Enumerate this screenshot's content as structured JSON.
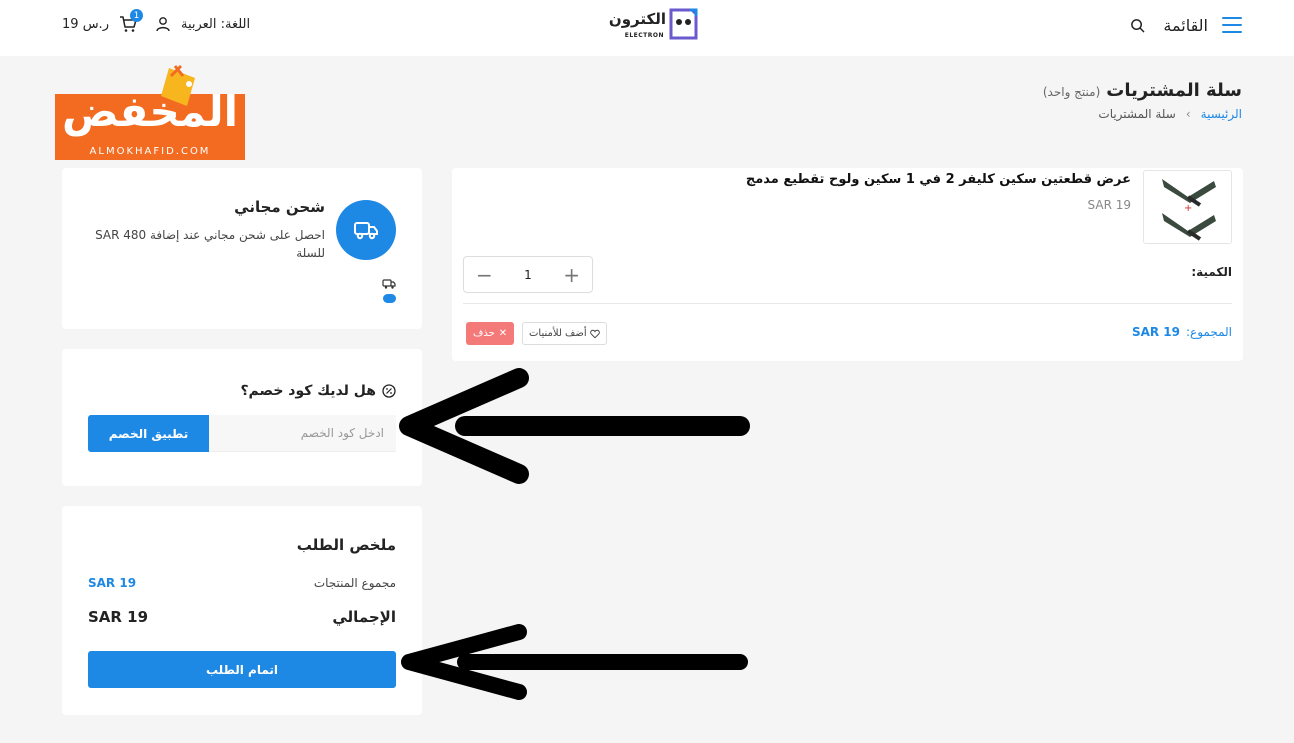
{
  "header": {
    "menu_label": "القائمة",
    "logo_ar": "الكترون",
    "logo_en": "ELECTRON",
    "language_label": "اللغة: العربية",
    "cart_total": "19 ر.س",
    "cart_count": "1"
  },
  "promo": {
    "text_ar": "المخفض",
    "text_en": "ALMOKHAFID.COM"
  },
  "page": {
    "title": "سلة المشتريات",
    "subtitle": "(منتج واحد)",
    "breadcrumb_home": "الرئيسية",
    "breadcrumb_sep": "›",
    "breadcrumb_current": "سلة المشتريات"
  },
  "product": {
    "name": "عرض قطعتين سكين كليفر 2 في 1 سكين ولوح تقطيع مدمج",
    "price": "SAR 19",
    "quantity_label": "الكمية:",
    "quantity": "1",
    "subtotal_label": "المجموع:",
    "subtotal_value": "SAR 19",
    "wishlist_label": "أضف للأمنيات",
    "delete_label": "حذف"
  },
  "shipping": {
    "title": "شحن مجاني",
    "description": "احصل على شحن مجاني عند إضافة 480 SAR للسلة"
  },
  "coupon": {
    "title": "هل لديك كود خصم؟",
    "placeholder": "ادخل كود الخصم",
    "apply_label": "تطبيق الخصم"
  },
  "summary": {
    "title": "ملخص الطلب",
    "products_total_label": "مجموع المنتجات",
    "products_total_value": "SAR 19",
    "grand_total_label": "الإجمالي",
    "grand_total_value": "SAR 19",
    "checkout_label": "اتمام الطلب"
  },
  "colors": {
    "accent": "#1e88e5",
    "promo_orange": "#f26b21",
    "delete_red": "#f47a7a",
    "background": "#f5f5f5"
  },
  "icons": [
    "hamburger-icon",
    "search-icon",
    "user-icon",
    "cart-icon",
    "truck-icon",
    "discount-icon",
    "heart-icon",
    "close-icon",
    "plus-icon",
    "minus-icon"
  ]
}
